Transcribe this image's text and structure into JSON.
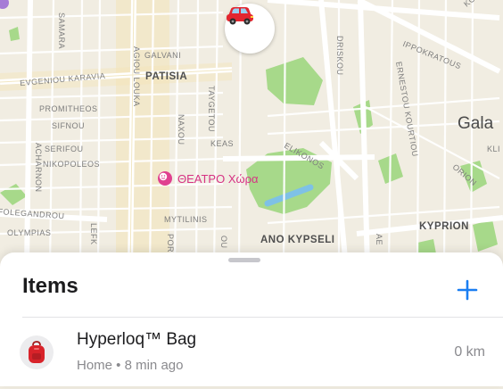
{
  "map": {
    "labels": {
      "samara": "SAMARA",
      "galvani": "GALVANI",
      "agiou_louka": "AGIOU LOUKA",
      "evgeniou_karavia": "EVGENIOU KARAVIA",
      "patisia": "PATISIA",
      "taygetou": "TAYGETOU",
      "prometheos": "PROMITHEOS",
      "sifnou": "SIFNOU",
      "serifou": "SERIFOU",
      "nikopoleos": "NIKOPOLEOS",
      "acharnon": "ACHARNON",
      "naxou": "NAXOU",
      "keas": "KEAS",
      "elikonos": "ELIKONOS",
      "driskou": "DRISKOU",
      "ippokratous": "IPPOKRATOUS",
      "ernestou_kourtiou": "ERNESTOU KOURTIOU",
      "gala": "Gala",
      "kli": "KLI",
      "orion": "ORION",
      "kyprion": "KYPRION",
      "folegandrou": "FOLEGANDROU",
      "olympias": "OLYMPIAS",
      "lefk": "LEFK",
      "mytilinis": "MYTILINIS",
      "por": "POR",
      "ou": "OU",
      "ano_kypseli": "ANO KYPSELI",
      "ae": "AE",
      "ko": "KO"
    },
    "theatre_label": "ΘΕΑΤΡΟ Χώρα",
    "car_marker_icon": "car-icon"
  },
  "sheet": {
    "title": "Items",
    "add_icon": "plus-icon",
    "items": [
      {
        "icon": "backpack-icon",
        "name": "Hyperloq™ Bag",
        "subtitle": "Home • 8 min ago",
        "distance": "0 km"
      }
    ]
  },
  "colors": {
    "accent": "#1a7ef2",
    "park": "#a7d98a",
    "water": "#7ec1e6",
    "road": "#ffffff",
    "theatre": "#d63384"
  }
}
